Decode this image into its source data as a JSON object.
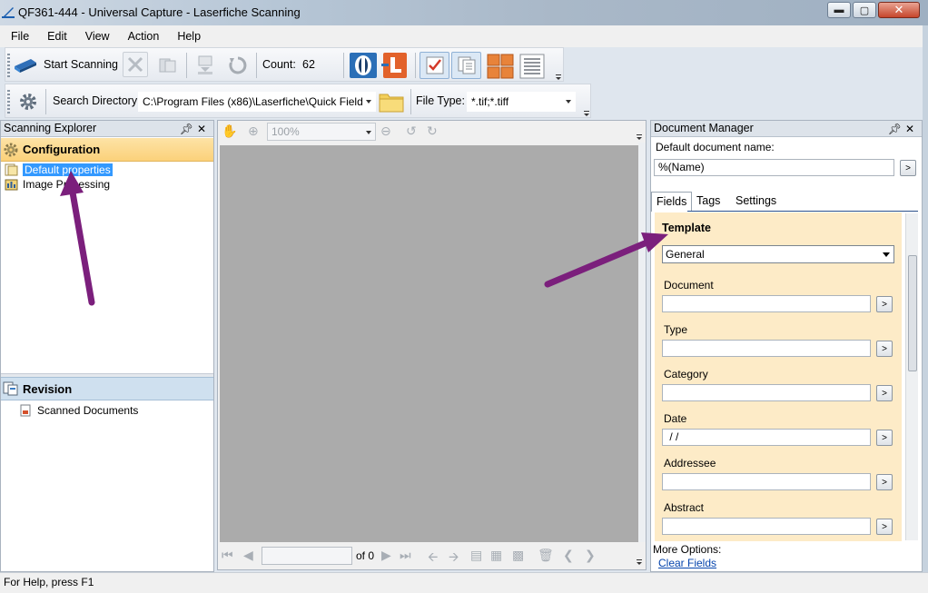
{
  "window": {
    "title": "QF361-444 - Universal Capture - Laserfiche Scanning",
    "icon": "laserfiche-logo-icon",
    "controls": [
      "minimize-icon",
      "maximize-icon",
      "close-icon"
    ]
  },
  "menu": {
    "items": [
      "File",
      "Edit",
      "View",
      "Action",
      "Help"
    ]
  },
  "toolbar": {
    "start_scanning": "Start Scanning",
    "count_label": "Count:",
    "count_value": "62",
    "search_directory_label": "Search Directory:",
    "search_directory_value": "C:\\Program Files (x86)\\Laserfiche\\Quick Field",
    "file_type_label": "File Type:",
    "file_type_value": "*.tif;*.tiff"
  },
  "scanning_explorer": {
    "title": "Scanning Explorer",
    "configuration": {
      "label": "Configuration",
      "items": [
        "Default properties",
        "Image Processing"
      ]
    },
    "revision": {
      "label": "Revision",
      "items": [
        "Scanned Documents"
      ]
    }
  },
  "viewer": {
    "zoom_value": "100%",
    "page_of": "of 0",
    "page_value": ""
  },
  "document_manager": {
    "title": "Document Manager",
    "default_name_label": "Default document name:",
    "default_name_value": "%(Name)",
    "tabs": [
      "Fields",
      "Tags",
      "Settings"
    ],
    "active_tab": "Fields",
    "template_label": "Template",
    "template_value": "General",
    "fields": [
      {
        "label": "Document",
        "value": ""
      },
      {
        "label": "Type",
        "value": ""
      },
      {
        "label": "Category",
        "value": ""
      },
      {
        "label": "Date",
        "value": " / /"
      },
      {
        "label": "Addressee",
        "value": ""
      },
      {
        "label": "Abstract",
        "value": ""
      }
    ],
    "more_options_label": "More Options:",
    "clear_fields_link": "Clear Fields"
  },
  "status_bar": {
    "text": "For Help, press F1"
  },
  "colors": {
    "configuration_bar": "#fbd17a",
    "revision_bar": "#cfe0ef",
    "fields_background": "#fdebc7",
    "selection": "#3399ff",
    "annotation_arrow": "#7b1f7c"
  }
}
